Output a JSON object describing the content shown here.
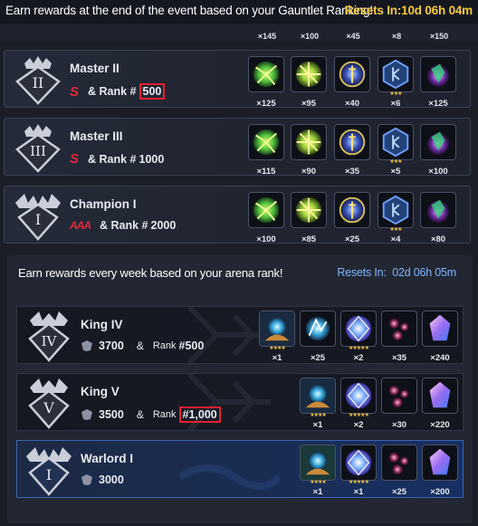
{
  "gauntlet": {
    "message": "Earn rewards at the end of the event based on your Gauntlet Ranking!",
    "reset_label": "Resets In:",
    "reset_time": "10d 06h 04m",
    "peek_quantities": [
      "×145",
      "×100",
      "×45",
      "×8",
      "×150"
    ],
    "tiers": [
      {
        "name": "Master II",
        "badge": "S",
        "rank_prefix": "& Rank #",
        "rank_value": "500",
        "quantities": [
          "×125",
          "×95",
          "×40",
          "×6",
          "×125"
        ]
      },
      {
        "name": "Master III",
        "badge": "S",
        "rank_prefix": "& Rank #",
        "rank_value": "1000",
        "quantities": [
          "×115",
          "×90",
          "×35",
          "×5",
          "×100"
        ]
      },
      {
        "name": "Champion I",
        "badge": "AAA",
        "rank_prefix": "& Rank #",
        "rank_value": "2000",
        "quantities": [
          "×100",
          "×85",
          "×25",
          "×4",
          "×80"
        ]
      }
    ]
  },
  "arena": {
    "message": "Earn rewards every week based on your arena rank!",
    "reset_label": "Resets In:",
    "reset_time": "02d 06h 05m",
    "tiers": [
      {
        "name": "King IV",
        "points": "3700",
        "amp": "&",
        "rank_label": "Rank",
        "rank_value": "#500",
        "quantities": [
          "×1",
          "×25",
          "×2",
          "×35",
          "×240"
        ]
      },
      {
        "name": "King V",
        "points": "3500",
        "amp": "&",
        "rank_label": "Rank",
        "rank_value": "#1,000",
        "quantities": [
          "×1",
          "×2",
          "×30",
          "×220"
        ]
      },
      {
        "name": "Warlord I",
        "points": "3000",
        "quantities": [
          "×1",
          "×1",
          "×25",
          "×200"
        ]
      }
    ]
  },
  "colors": {
    "gauntlet_reset": "#f7c93b",
    "arena_reset": "#7fb4ff",
    "highlight_box": "#e5202f",
    "selected_band": "#1a2c52"
  }
}
